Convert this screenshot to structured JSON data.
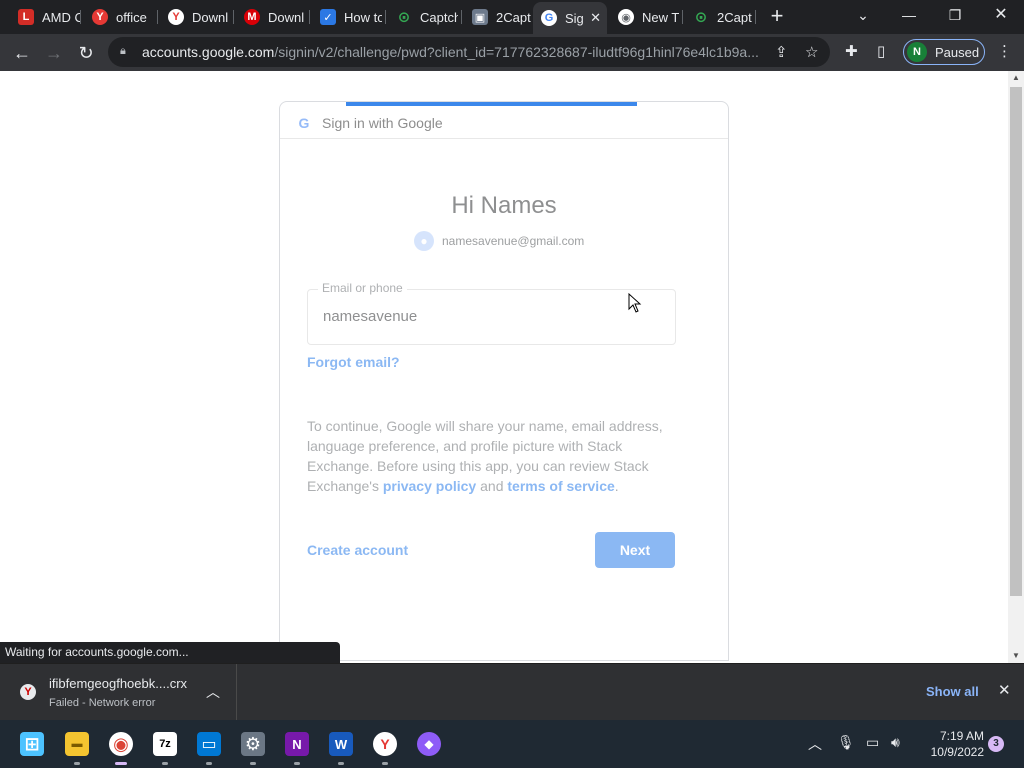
{
  "browser": {
    "tabs": [
      {
        "label": "AMD C",
        "icon": "lastpass-icon",
        "icon_char": "L",
        "color": "#d32d27"
      },
      {
        "label": "office",
        "icon": "yandex-icon",
        "icon_char": "Y",
        "color": "#e53935"
      },
      {
        "label": "Downl",
        "icon": "yandex-icon",
        "icon_char": "Y",
        "color": "#ffffff"
      },
      {
        "label": "Downl",
        "icon": "mega-icon",
        "icon_char": "M",
        "color": "#d90007"
      },
      {
        "label": "How to",
        "icon": "checkmark-icon",
        "icon_char": "✓",
        "color": "#2b78e4"
      },
      {
        "label": "Captch",
        "icon": "lock-icon",
        "icon_char": "⊙",
        "color": "#1e8e3e"
      },
      {
        "label": "2Capt",
        "icon": "image-icon",
        "icon_char": "▣",
        "color": "#6d7a8c"
      },
      {
        "label": "Sig",
        "icon": "google-icon",
        "icon_char": "G",
        "color": "#ffffff"
      },
      {
        "label": "New T",
        "icon": "chrome-icon",
        "icon_char": "◉",
        "color": "#ffffff"
      },
      {
        "label": "2Capt",
        "icon": "lock-icon",
        "icon_char": "⊙",
        "color": "#1e8e3e"
      }
    ],
    "active_tab_index": 7,
    "url_host": "accounts.google.com",
    "url_path": "/signin/v2/challenge/pwd?client_id=717762328687-iludtf96g1hinl76e4lc1b9a...",
    "profile_initial": "N",
    "profile_label": "Paused",
    "status_text": "Waiting for accounts.google.com..."
  },
  "signin": {
    "header": "Sign in with Google",
    "greeting": "Hi Names",
    "account_email": "namesavenue@gmail.com",
    "field_label": "Email or phone",
    "field_value": "namesavenue",
    "forgot_email": "Forgot email?",
    "consent_prefix": "To continue, Google will share your name, email address, language preference, and profile picture with Stack Exchange. Before using this app, you can review Stack Exchange's",
    "privacy_policy": "privacy policy",
    "and_text": "and",
    "terms_of_service": "terms of service",
    "period": ".",
    "create_account": "Create account",
    "next_label": "Next"
  },
  "download": {
    "filename": "ifibfemgeogfhoebk....crx",
    "status": "Failed - Network error",
    "show_all": "Show all"
  },
  "taskbar": {
    "apps": [
      {
        "name": "start-icon",
        "char": "⊞"
      },
      {
        "name": "file-explorer-icon",
        "char": "▬"
      },
      {
        "name": "chrome-icon",
        "char": "◉"
      },
      {
        "name": "7zip-icon",
        "char": "7z"
      },
      {
        "name": "remote-desktop-icon",
        "char": "▭"
      },
      {
        "name": "settings-icon",
        "char": "⚙"
      },
      {
        "name": "onenote-icon",
        "char": "N"
      },
      {
        "name": "word-icon",
        "char": "W"
      },
      {
        "name": "yandex-browser-icon",
        "char": "Y"
      },
      {
        "name": "alice-icon",
        "char": "◆"
      }
    ],
    "time": "7:19 AM",
    "date": "10/9/2022",
    "notification_count": "3"
  }
}
